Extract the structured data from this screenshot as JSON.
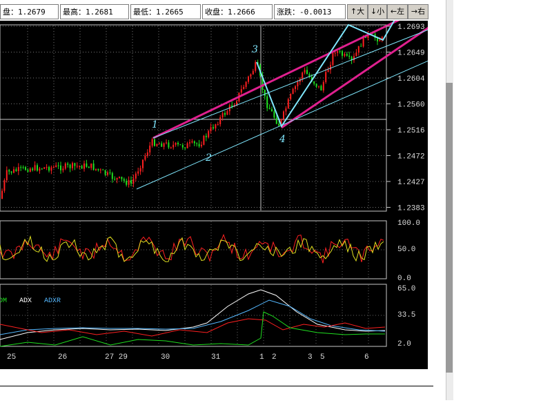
{
  "quote_bar": {
    "open": "盘：1.2679",
    "high": "最高：1.2681",
    "low": "最低：1.2665",
    "close": "收盘：1.2666",
    "change": "涨跌：-0.0013"
  },
  "toolbar": {
    "zoom_in": "↑大",
    "zoom_out": "↓小",
    "left": "←左",
    "right": "→右"
  },
  "price_axis": [
    "1.2693",
    "1.2649",
    "1.2604",
    "1.2560",
    "1.2516",
    "1.2472",
    "1.2427",
    "1.2383"
  ],
  "rsi_axis": [
    "100.0",
    "50.0",
    "0.0"
  ],
  "dmi_axis": [
    "65.0",
    "33.5",
    "2.0"
  ],
  "dmi_legend": [
    "DM",
    "ADX",
    "ADXR"
  ],
  "date_axis": [
    "25",
    "26",
    "27 29",
    "30",
    "31",
    "1",
    "2",
    "3",
    "5",
    "6"
  ],
  "wave_labels": [
    "1",
    "2",
    "3",
    "4"
  ],
  "colors": {
    "up": "#ff2020",
    "down": "#20e020",
    "channel": "#e0208f",
    "trend": "#80e8ff",
    "grid": "#c8c8c8",
    "adx": "#ffffff",
    "adxr": "#55b8ff"
  }
}
